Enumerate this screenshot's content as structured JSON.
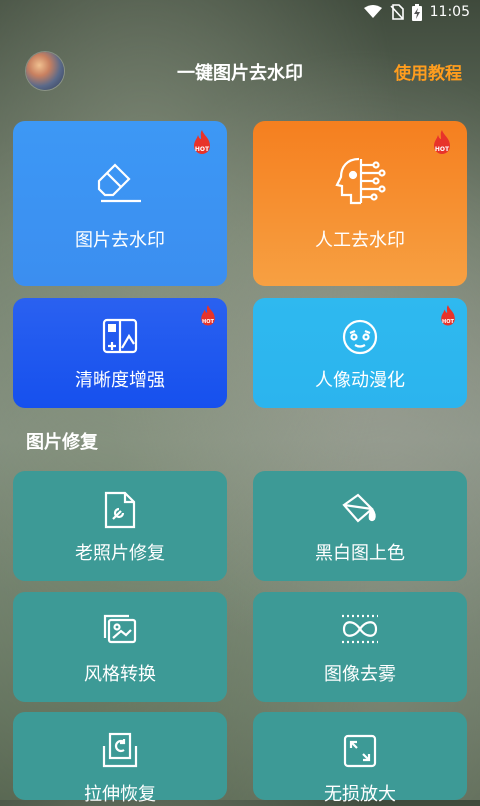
{
  "status_bar": {
    "time": "11:05"
  },
  "header": {
    "title": "一键图片去水印",
    "tutorial": "使用教程"
  },
  "hot_badge": "HOT",
  "top_cards": [
    {
      "label": "图片去水印",
      "icon": "eraser-icon",
      "hot": true
    },
    {
      "label": "人工去水印",
      "icon": "ai-head-icon",
      "hot": true
    },
    {
      "label": "清晰度增强",
      "icon": "enhance-icon",
      "hot": true
    },
    {
      "label": "人像动漫化",
      "icon": "anime-face-icon",
      "hot": true
    }
  ],
  "section": {
    "title": "图片修复"
  },
  "repair_cards": [
    {
      "label": "老照片修复",
      "icon": "photo-repair-icon"
    },
    {
      "label": "黑白图上色",
      "icon": "paint-bucket-icon"
    },
    {
      "label": "风格转换",
      "icon": "style-transfer-icon"
    },
    {
      "label": "图像去雾",
      "icon": "dehaze-icon"
    },
    {
      "label": "拉伸恢复",
      "icon": "stretch-restore-icon"
    },
    {
      "label": "无损放大",
      "icon": "expand-icon"
    }
  ],
  "colors": {
    "accent": "#ff9d1e",
    "card_blue": "#3b8ef0",
    "card_orange": "#f7a042",
    "card_deep_blue": "#1650ee",
    "card_cyan": "#2bb4ee",
    "card_teal": "#3d9a96",
    "hot_red": "#e8332a"
  }
}
